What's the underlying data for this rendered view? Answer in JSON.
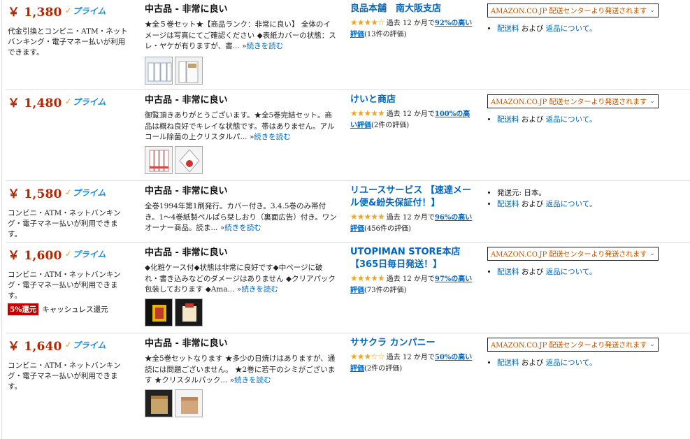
{
  "offers": [
    {
      "price": "￥ 1,380",
      "prime_label": "プライム",
      "payment_note": "代金引換とコンビニ・ATM・ネットバンキング・電子マネー払いが利用できます。",
      "condition": "中古品 - 非常に良い",
      "description": "★全５巻セット★【商品ランク：非常に良い】 全体のイメージは写真にてご確認ください ◆表紙カバーの状態：スレ・ヤケが有りますが、書... »",
      "read_more": "続きを読む",
      "seller": "良品本舗　南大阪支店",
      "stars": "★★★★☆",
      "rating_prefix": "過去 12 か月で",
      "rating_pct": "92%の高い評価",
      "rating_count": "(13件の評価)",
      "ship_label": "AMAZON.CO.JP 配送センターより発送されます",
      "ship_from": "",
      "fee_link": "配送料",
      "and_text": " および ",
      "return_link": "返品について。"
    },
    {
      "price": "￥ 1,480",
      "prime_label": "プライム",
      "payment_note": "",
      "condition": "中古品 - 非常に良い",
      "description": "御覧頂きありがとうございます。★全5巻完結セット。商品は概ね良好でキレイな状態です。帯はありません。アルコール除菌の上クリスタルパ... »",
      "read_more": "続きを読む",
      "seller": "けいと商店",
      "stars": "★★★★★",
      "rating_prefix": "過去 12 か月で",
      "rating_pct": "100%の高い評価",
      "rating_count": "(2件の評価)",
      "ship_label": "AMAZON.CO.JP 配送センターより発送されます",
      "ship_from": "",
      "fee_link": "配送料",
      "and_text": " および ",
      "return_link": "返品について。"
    },
    {
      "price": "￥ 1,580",
      "prime_label": "プライム",
      "payment_note": "コンビニ・ATM・ネットバンキング・電子マネー払いが利用できます。",
      "condition": "中古品 - 非常に良い",
      "description": "全巻1994年第1刷発行。カバー付き。3.4.5巻のみ帯付き。1〜4巻紙製ペルぱら栞しおり（裏面広告）付き。ワンオーナー商品。読ま... »",
      "read_more": "続きを読む",
      "seller": "リユースサービス 【速達メール便&紛失保証付！】",
      "stars": "★★★★★",
      "rating_prefix": "過去 12 か月で",
      "rating_pct": "96%の高い評価",
      "rating_count": "(456件の評価)",
      "ship_label": "",
      "ship_from": "発送元: 日本。",
      "fee_link": "配送料",
      "and_text": " および ",
      "return_link": "返品について。"
    },
    {
      "price": "￥ 1,600",
      "prime_label": "プライム",
      "payment_note": "コンビニ・ATM・ネットバンキング・電子マネー払いが利用できます。",
      "cashback_badge": "5%還元",
      "cashback_text": "キャッシュレス還元",
      "condition": "中古品 - 非常に良い",
      "description": "◆化粧ケース付◆状態は非常に良好です◆中ページに破れ・書き込みなどのダメージはありません ◆クリアパック包装しております ◆Ama... »",
      "read_more": "続きを読む",
      "seller": "UTOPIMAN STORE本店【365日毎日発送！】",
      "stars": "★★★★★",
      "rating_prefix": "過去 12 か月で",
      "rating_pct": "97%の高い評価",
      "rating_count": "(73件の評価)",
      "ship_label": "AMAZON.CO.JP 配送センターより発送されます",
      "ship_from": "",
      "fee_link": "配送料",
      "and_text": " および ",
      "return_link": "返品について。"
    },
    {
      "price": "￥ 1,640",
      "prime_label": "プライム",
      "payment_note": "コンビニ・ATM・ネットバンキング・電子マネー払いが利用できます。",
      "condition": "中古品 - 非常に良い",
      "description": "★全5巻セットなります ★多少の日焼けはありますが、通読には問題ございません。 ★2巻に若干のシミがございます ★クリスタルパック... »",
      "read_more": "続きを読む",
      "seller": "ササクラ カンパニー",
      "stars": "★★★☆☆",
      "rating_prefix": "過去 12 か月で",
      "rating_pct": "50%の高い評価",
      "rating_count": "(2件の評価)",
      "ship_label": "AMAZON.CO.JP 配送センターより発送されます",
      "ship_from": "",
      "fee_link": "配送料",
      "and_text": " および ",
      "return_link": "返品について。"
    }
  ],
  "colors": {
    "price": "#b12704",
    "link": "#0066c0",
    "ship_label": "#c45500",
    "prime": "#1f8fd6",
    "star": "#f4a41c",
    "badge": "#c40000"
  }
}
